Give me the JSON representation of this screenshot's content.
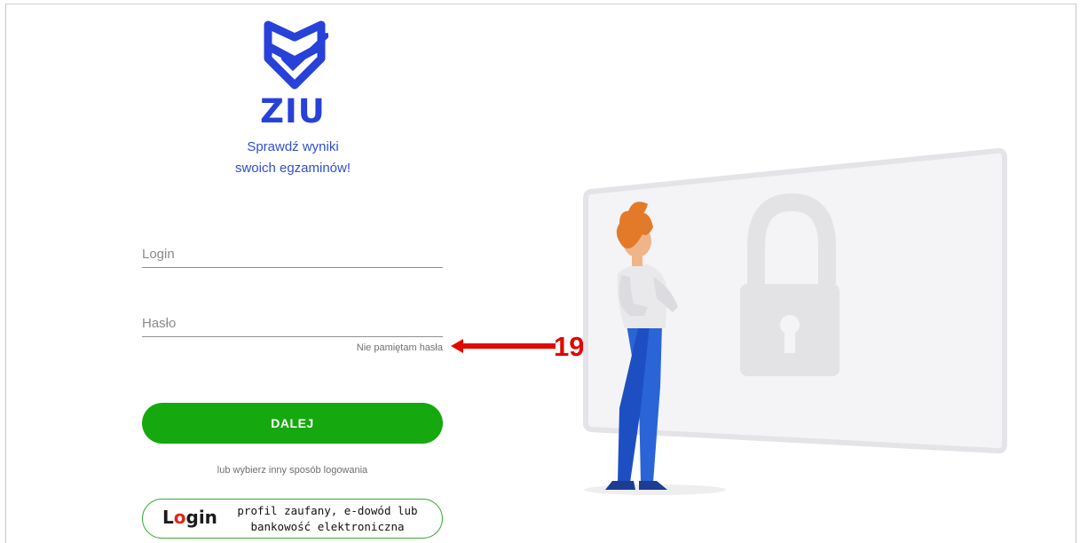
{
  "brand": {
    "name": "ZIU",
    "tagline_line1": "Sprawdź wyniki",
    "tagline_line2": "swoich egzaminów!"
  },
  "form": {
    "login_label": "Login",
    "password_label": "Hasło",
    "forgot_password": "Nie pamiętam hasła",
    "submit_label": "DALEJ",
    "alt_login_text": "lub wybierz inny sposób logowania"
  },
  "alt_login": {
    "logo_text_pre": "L",
    "logo_text_o": "o",
    "logo_text_post": "gin",
    "line1": "profil zaufany, e-dowód lub",
    "line2": "bankowość elektroniczna"
  },
  "annotation": {
    "number": "19",
    "color": "#e10600"
  },
  "colors": {
    "brand_blue": "#2741d9",
    "button_green": "#16a80f",
    "alt_border_green": "#3aaa35"
  },
  "icons": [
    "ziu-shield-logo-icon",
    "padlock-icon",
    "person-illustration"
  ]
}
